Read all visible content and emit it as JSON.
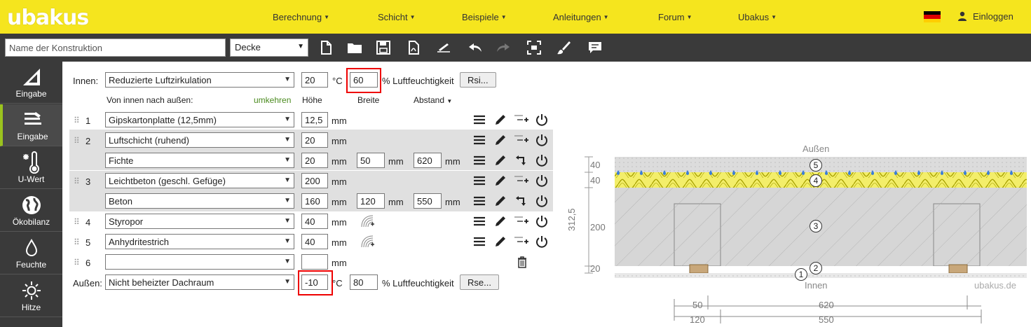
{
  "brand": {
    "logo": "ubakus"
  },
  "nav": [
    {
      "label": "Berechnung"
    },
    {
      "label": "Schicht"
    },
    {
      "label": "Beispiele"
    },
    {
      "label": "Anleitungen"
    },
    {
      "label": "Forum"
    },
    {
      "label": "Ubakus"
    }
  ],
  "login": {
    "label": "Einloggen"
  },
  "toolbar": {
    "name_placeholder": "Name der Konstruktion",
    "type_value": "Decke",
    "icons": [
      "new-file-icon",
      "open-folder-icon",
      "save-icon",
      "pdf-icon",
      "sign-icon",
      "undo-icon",
      "redo-icon",
      "fullscreen-icon",
      "brush-icon",
      "comment-icon"
    ]
  },
  "sidebar": [
    {
      "label": "Eingabe",
      "icon": "ruler-icon"
    },
    {
      "label": "Eingabe",
      "icon": "layers-icon",
      "active": true
    },
    {
      "label": "U-Wert",
      "icon": "thermometer-icon"
    },
    {
      "label": "Ökobilanz",
      "icon": "globe-icon"
    },
    {
      "label": "Feuchte",
      "icon": "drop-icon"
    },
    {
      "label": "Hitze",
      "icon": "sun-icon"
    }
  ],
  "form": {
    "inside_label": "Innen:",
    "inside_condition": "Reduzierte Luftzirkulation",
    "inside_temp": "20",
    "inside_temp_unit": "°C",
    "inside_humidity": "60",
    "humidity_unit": "% Luftfeuchtigkeit",
    "rsi_button": "Rsi...",
    "order_label": "Von innen nach außen:",
    "reverse_link": "umkehren",
    "col_height": "Höhe",
    "col_width": "Breite",
    "col_spacing": "Abstand",
    "unit_mm": "mm",
    "layers": [
      {
        "num": "1",
        "material": "Gipskartonplatte (12,5mm)",
        "height": "12,5"
      },
      {
        "num": "2",
        "material": "Luftschicht (ruhend)",
        "height": "20",
        "sub": {
          "material": "Fichte",
          "height": "20",
          "width": "50",
          "spacing": "620"
        }
      },
      {
        "num": "3",
        "material": "Leichtbeton (geschl. Gefüge)",
        "height": "200",
        "sub": {
          "material": "Beton",
          "height": "160",
          "width": "120",
          "spacing": "550"
        }
      },
      {
        "num": "4",
        "material": "Styropor",
        "height": "40"
      },
      {
        "num": "5",
        "material": "Anhydritestrich",
        "height": "40"
      },
      {
        "num": "6",
        "material": "",
        "height": ""
      }
    ],
    "outside_label": "Außen:",
    "outside_condition": "Nicht beheizter Dachraum",
    "outside_temp": "-10",
    "outside_temp_unit": "°C",
    "outside_humidity": "80",
    "rse_button": "Rse..."
  },
  "diagram": {
    "top_label": "Außen",
    "bottom_label": "Innen",
    "watermark": "ubakus.de",
    "total": "312,5",
    "dims_left": [
      "40",
      "40",
      "200",
      "20"
    ],
    "dims_bottom_1": [
      "50",
      "620"
    ],
    "dims_bottom_2": [
      "120",
      "550"
    ],
    "markers": [
      "5",
      "4",
      "3",
      "2",
      "1"
    ]
  },
  "colors": {
    "brand_yellow": "#f5e51e",
    "toolbar": "#3a3a3a",
    "active_accent": "#9bc31e",
    "highlight": "#e00000"
  }
}
